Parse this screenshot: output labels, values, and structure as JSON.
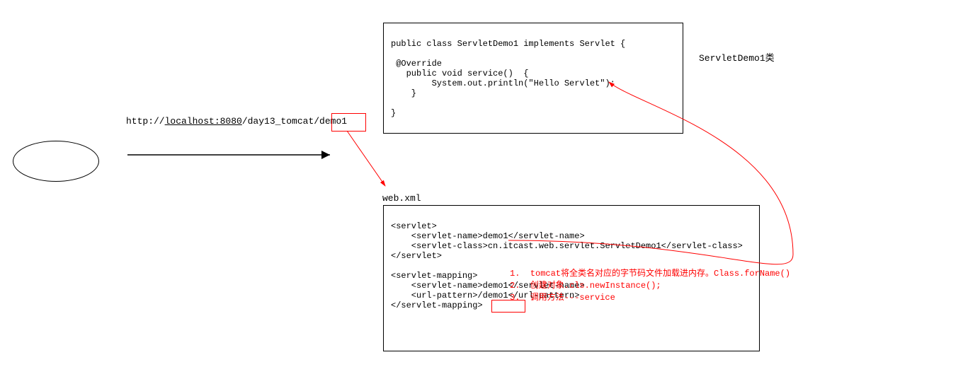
{
  "url": {
    "prefix": "http://",
    "host": "localhost:8080",
    "path1": "/day13_tomcat",
    "path2": "/demo1"
  },
  "webxml_label": "web.xml",
  "class_label": "ServletDemo1类",
  "servlet_code": {
    "line1": "public class ServletDemo1 implements Servlet {",
    "line2": "",
    "line3": " @Override",
    "line4": "   public void service()  {",
    "line5": "        System.out.println(\"Hello Servlet\");",
    "line6": "    }",
    "line7": "",
    "line8": "}"
  },
  "webxml_code": {
    "line1": "<servlet>",
    "line2": "    <servlet-name>demo1</servlet-name>",
    "line3": "    <servlet-class>cn.itcast.web.servlet.ServletDemo1</servlet-class>",
    "line4": "</servlet>",
    "line5": "",
    "line6": "<servlet-mapping>",
    "line7": "    <servlet-name>demo1</servlet-name>",
    "line8": "    <url-pattern>/demo1</url-pattern>",
    "line9": "</servlet-mapping>"
  },
  "red_notes": {
    "line1": "1.  tomcat将全类名对应的字节码文件加载进内存。Class.forName()",
    "line2": "2.  创建对象.cls.newInstance();",
    "line3": "3.  调用方法---service"
  }
}
